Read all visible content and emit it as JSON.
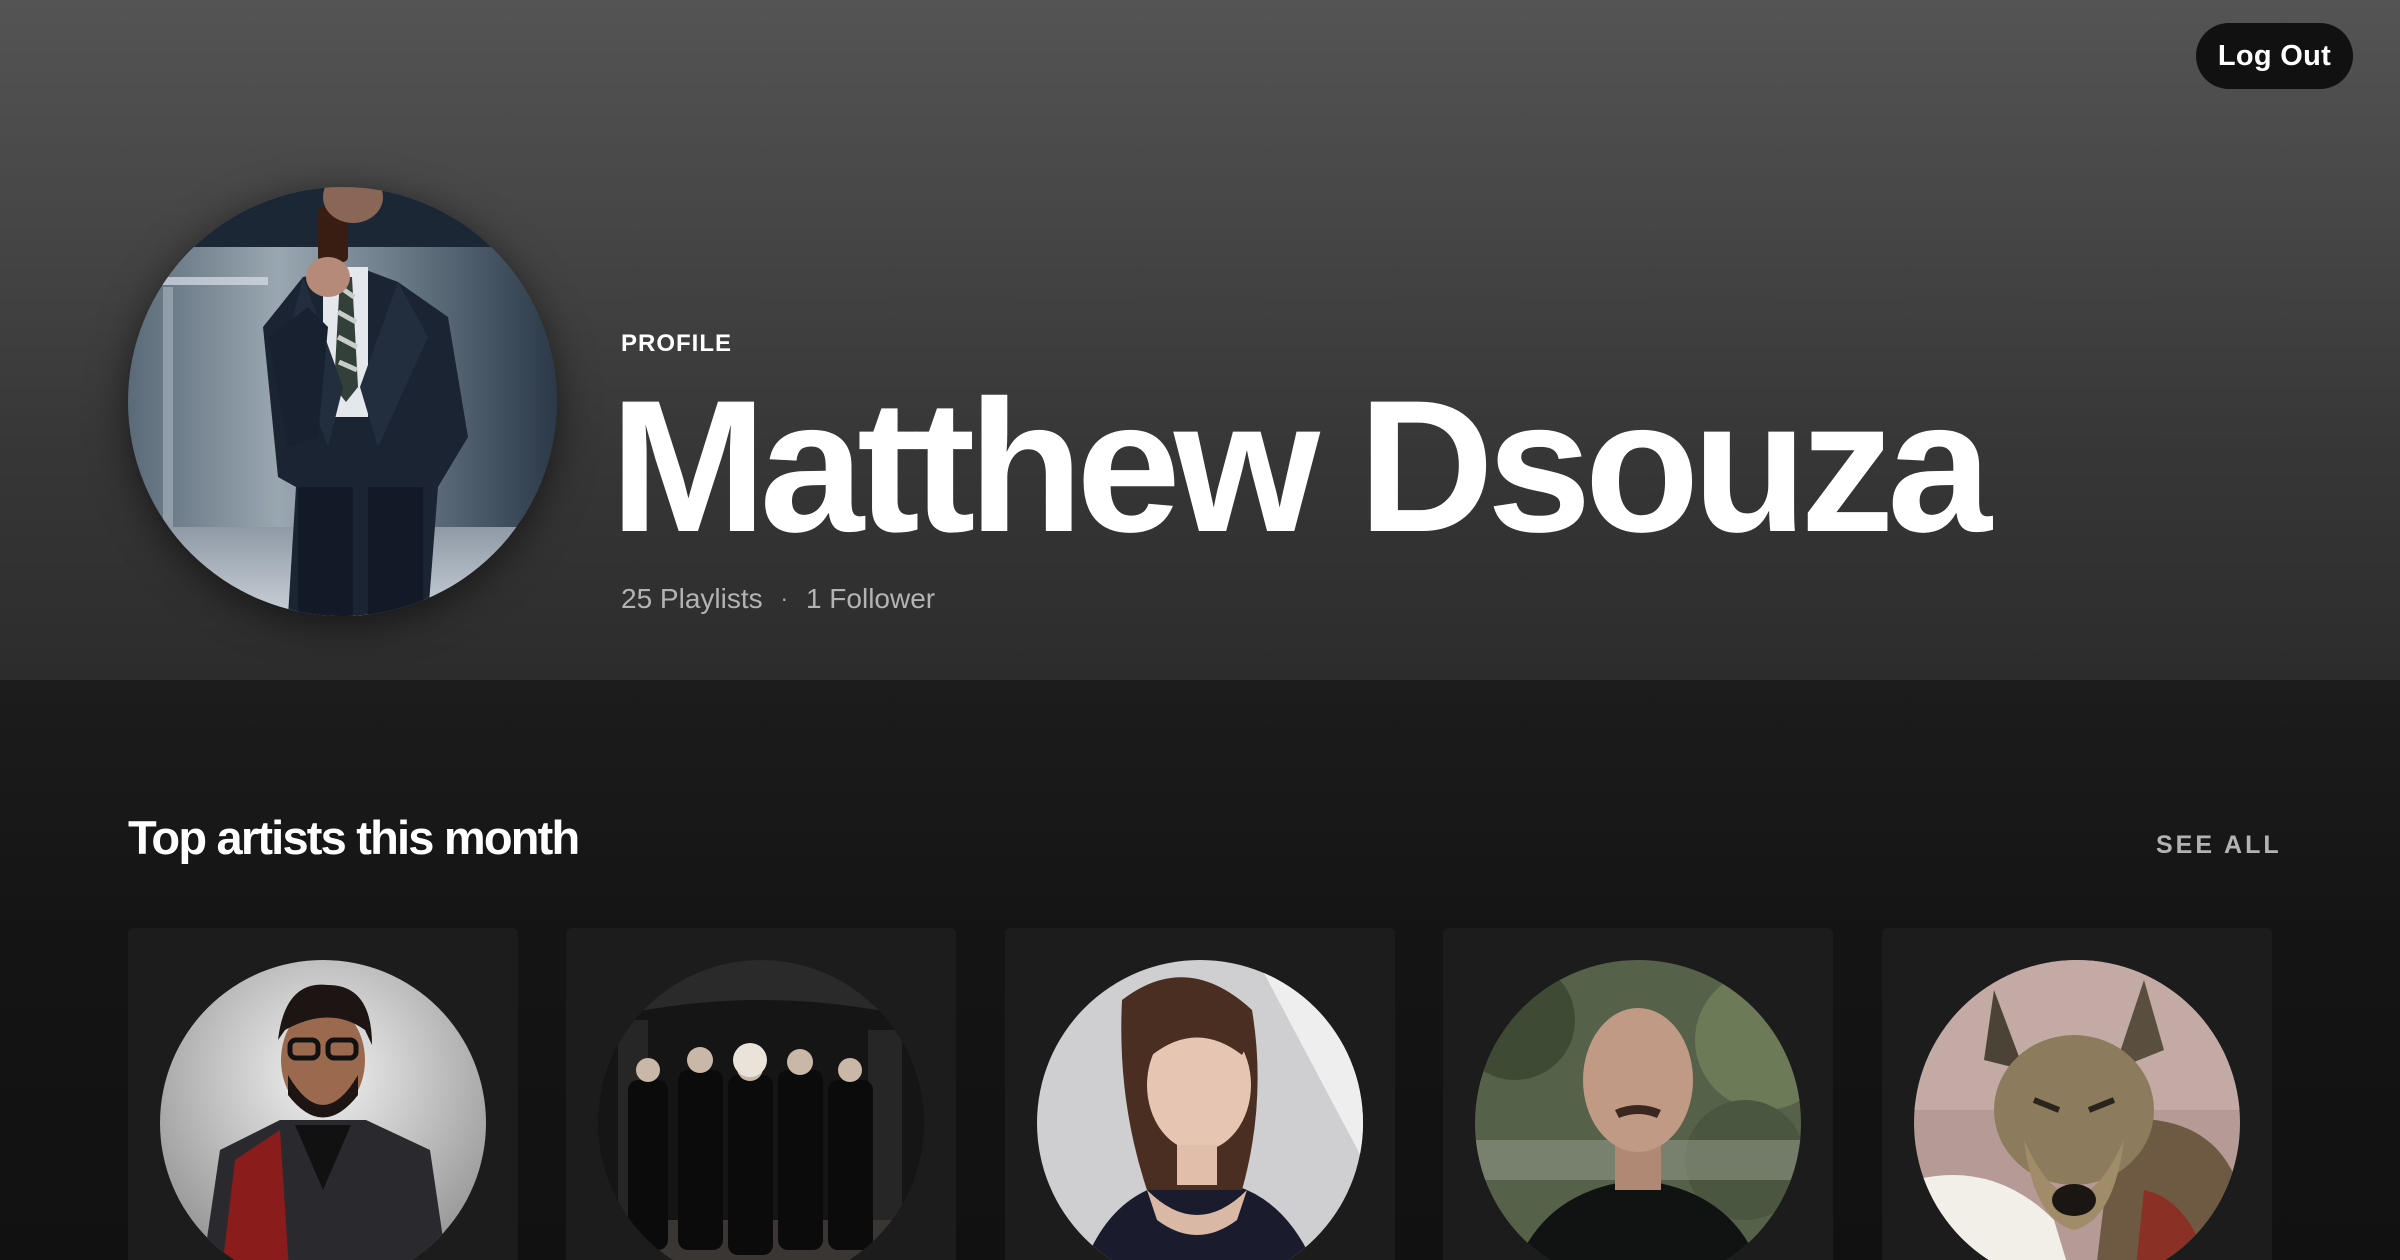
{
  "header": {
    "logout_label": "Log Out",
    "profile_type": "PROFILE",
    "name": "Matthew Dsouza",
    "playlists": "25 Playlists",
    "separator": "·",
    "followers": "1 Follower"
  },
  "top_artists": {
    "title": "Top artists this month",
    "see_all": "SEE ALL",
    "items": [
      {
        "image": "man-with-glasses-portrait"
      },
      {
        "image": "band-group-photo"
      },
      {
        "image": "woman-portrait"
      },
      {
        "image": "bald-man-portrait"
      },
      {
        "image": "dog-photo"
      }
    ]
  }
}
